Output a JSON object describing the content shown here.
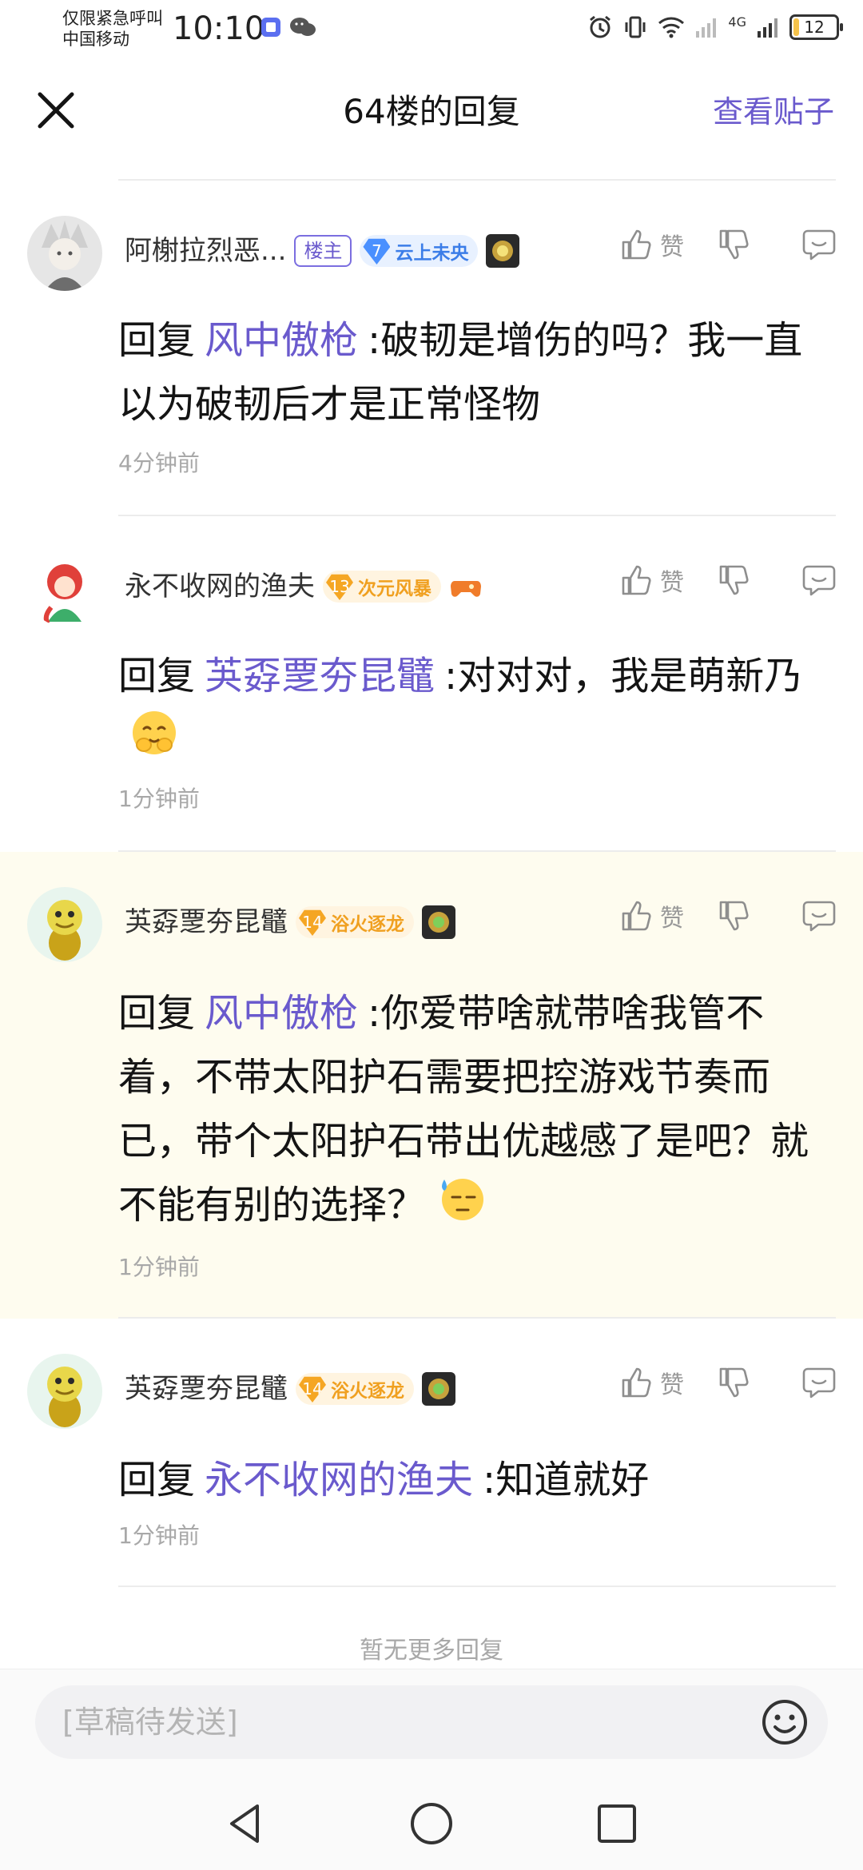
{
  "status_bar": {
    "carrier_line1": "仅限紧急呼叫",
    "carrier_line2": "中国移动",
    "time": "10:10",
    "network": "4G",
    "battery": "12"
  },
  "header": {
    "title": "64楼的回复",
    "view_post_label": "查看贴子"
  },
  "reply_prefix": "回复",
  "like_label": "赞",
  "replies": [
    {
      "username": "阿榭拉烈恶...",
      "host_badge": "楼主",
      "level": "7",
      "level_name": "云上未央",
      "mention": "风中傲枪",
      "text": ":破韧是增伤的吗？我一直以为破韧后才是正常怪物",
      "time": "4分钟前"
    },
    {
      "username": "永不收网的渔夫",
      "level": "13",
      "level_name": "次元风暴",
      "mention": "芵孬覂夯昆鼊",
      "text": ":对对对，我是萌新乃",
      "time": "1分钟前"
    },
    {
      "username": "芵孬覂夯昆鼊",
      "level": "14",
      "level_name": "浴火逐龙",
      "mention": "风中傲枪",
      "text": ":你爱带啥就带啥我管不着，不带太阳护石需要把控游戏节奏而已，带个太阳护石带出优越感了是吧？就不能有别的选择？",
      "time": "1分钟前"
    },
    {
      "username": "芵孬覂夯昆鼊",
      "level": "14",
      "level_name": "浴火逐龙",
      "mention": "永不收网的渔夫",
      "text": ":知道就好",
      "time": "1分钟前"
    }
  ],
  "footer": {
    "no_more": "暂无更多回复"
  },
  "composer": {
    "draft": "[草稿待发送]"
  },
  "colors": {
    "accent": "#6a5acd",
    "highlight_bg": "#fefcef",
    "muted": "#a8a8a8"
  }
}
